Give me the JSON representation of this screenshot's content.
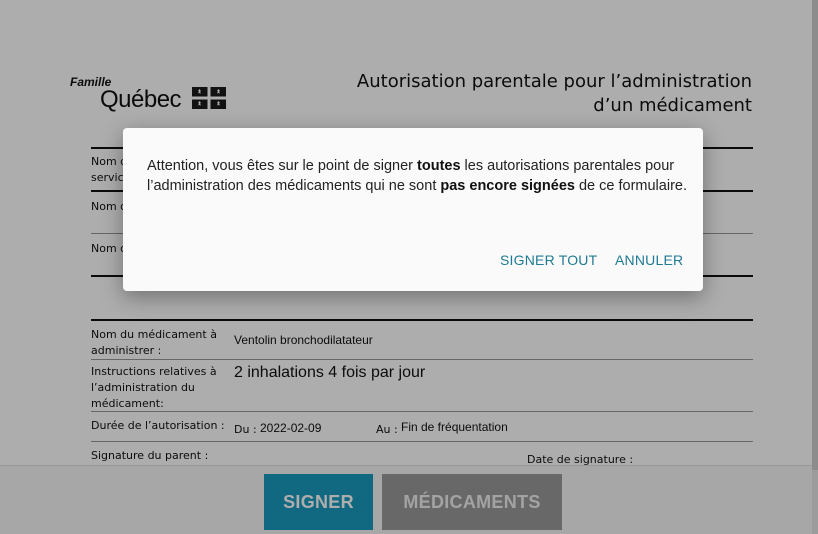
{
  "header": {
    "logo_famille": "Famille",
    "logo_quebec": "Québec",
    "title": "Autorisation parentale pour l’administration d’un médicament"
  },
  "form": {
    "labels": {
      "nom_service_partial_1": "Nom d",
      "nom_service_partial_2": "servic",
      "nom_partial_2": "Nom d",
      "nom_partial_3": "Nom d",
      "medicament": "Nom du médicament à administrer :",
      "instructions": "Instructions relatives à l’administration du médicament:",
      "duree": "Durée de l’autorisation :",
      "du_label": "Du :",
      "au_label": "Au :",
      "signature_parent": "Signature du parent :",
      "date_signature": "Date de signature :"
    },
    "values": {
      "medicament": "Ventolin bronchodilatateur",
      "instructions": "2 inhalations 4 fois par jour",
      "du": "2022-02-09",
      "au": "Fin de fréquentation"
    }
  },
  "buttons": {
    "signer": "SIGNER",
    "medicaments": "MÉDICAMENTS"
  },
  "dialog": {
    "message_parts": {
      "p1": "Attention, vous êtes sur le point de signer ",
      "b1": "toutes",
      "p2": " les autorisations parentales pour l’administration des médicaments qui ne sont ",
      "b2": "pas encore signées",
      "p3": " de ce formulaire."
    },
    "action_signer_tout": "SIGNER TOUT",
    "action_annuler": "ANNULER"
  },
  "colors": {
    "primary_button": "#1a9bbf",
    "secondary_button": "#9a9a9a",
    "dialog_action": "#1f7a93",
    "overlay": "rgba(0,0,0,0.32)"
  }
}
